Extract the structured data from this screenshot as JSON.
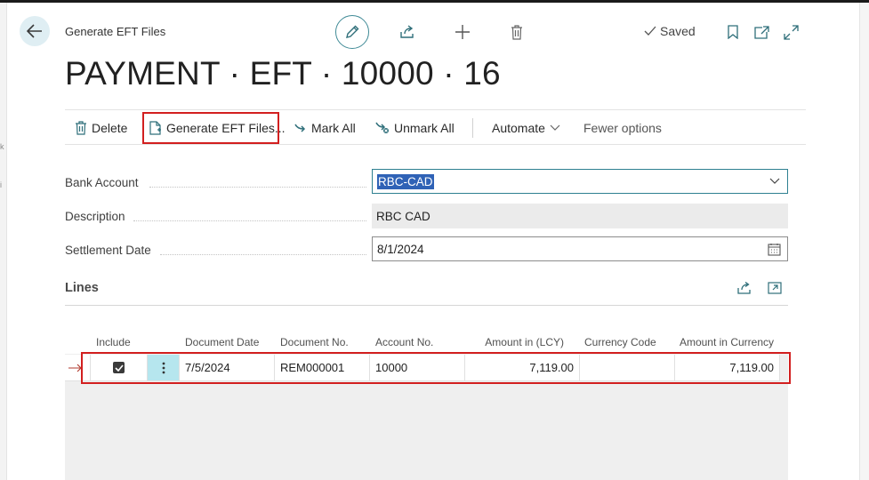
{
  "breadcrumb": "Generate EFT Files",
  "status": {
    "saved_label": "Saved"
  },
  "page_title": "PAYMENT · EFT · 10000 · 16",
  "actions": {
    "delete": "Delete",
    "generate": "Generate EFT Files...",
    "mark_all": "Mark All",
    "unmark_all": "Unmark All",
    "automate": "Automate",
    "fewer_options": "Fewer options"
  },
  "fields": {
    "bank_account": {
      "label": "Bank Account",
      "value": "RBC-CAD"
    },
    "description": {
      "label": "Description",
      "value": "RBC CAD"
    },
    "settlement_date": {
      "label": "Settlement Date",
      "value": "8/1/2024"
    }
  },
  "lines": {
    "title": "Lines",
    "columns": {
      "include": "Include",
      "document_date": "Document Date",
      "document_no": "Document No.",
      "account_no": "Account No.",
      "amount_lcy": "Amount in (LCY)",
      "currency_code": "Currency Code",
      "amount_currency": "Amount in Currency"
    },
    "rows": [
      {
        "include": true,
        "document_date": "7/5/2024",
        "document_no": "REM000001",
        "account_no": "10000",
        "amount_lcy": "7,119.00",
        "currency_code": "",
        "amount_currency": "7,119.00"
      }
    ]
  },
  "colors": {
    "accent": "#3f8a96",
    "highlight": "#d21f1f",
    "selection": "#2f62b6"
  }
}
